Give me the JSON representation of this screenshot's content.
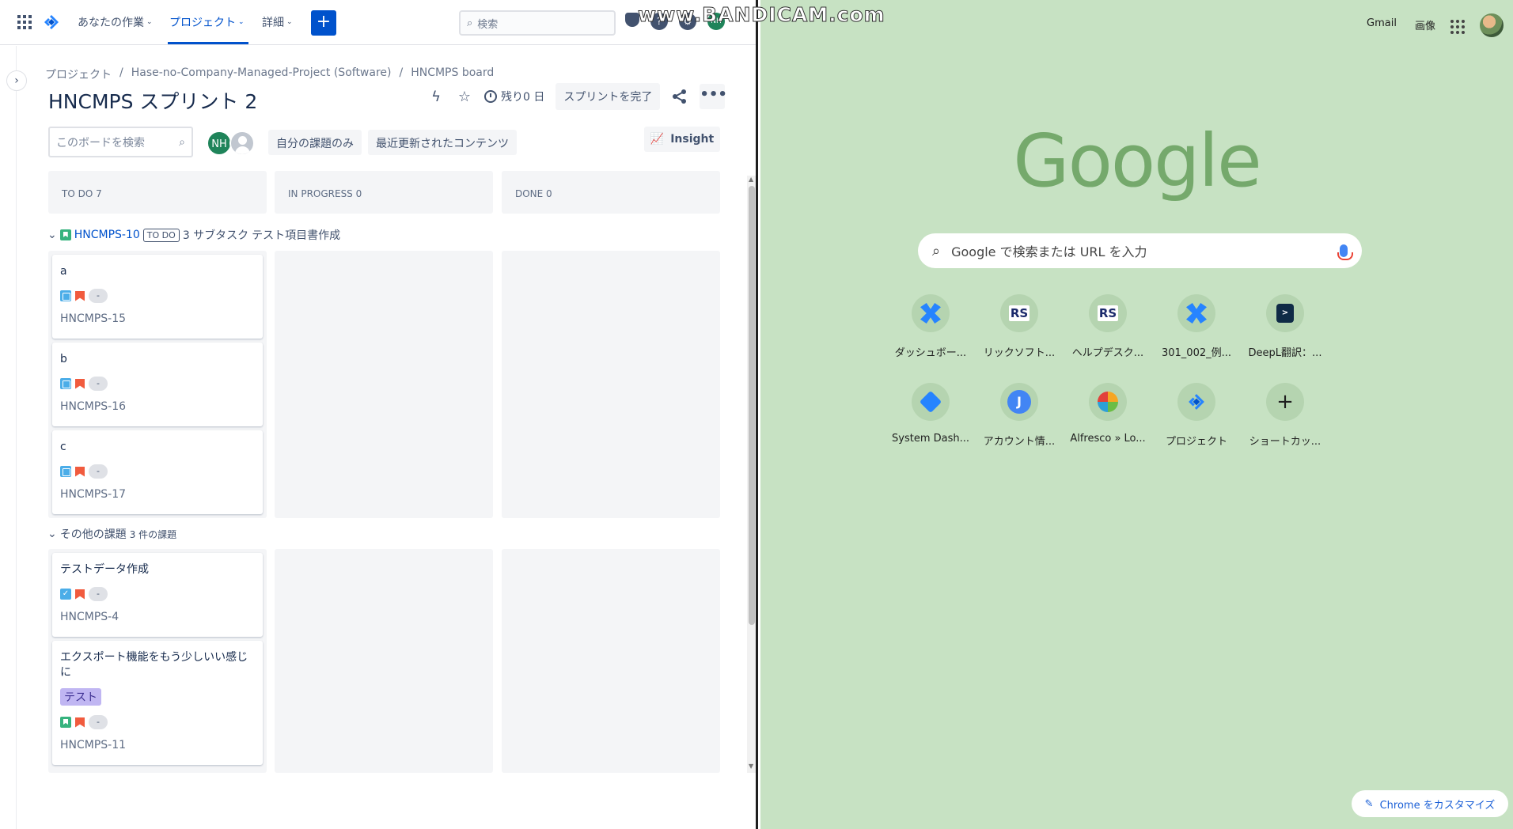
{
  "watermark": "www.BANDICAM.com",
  "jira": {
    "nav": {
      "your_work": "あなたの作業",
      "projects": "プロジェクト",
      "more": "詳細",
      "create": "+",
      "search_placeholder": "検索"
    },
    "breadcrumb": [
      "プロジェクト",
      "/",
      "Hase-no-Company-Managed-Project (Software)",
      "/",
      "HNCMPS board"
    ],
    "title": "HNCMPS スプリント 2",
    "remaining": "残り0 日",
    "complete_sprint": "スプリントを完了",
    "more_actions": "•••",
    "board_search_placeholder": "このボードを検索",
    "avatar_initials": "NH",
    "filters": {
      "only_my_issues": "自分の課題のみ",
      "recently_updated": "最近更新されたコンテンツ"
    },
    "insight": "Insight",
    "columns": [
      {
        "label": "TO DO 7"
      },
      {
        "label": "IN PROGRESS 0"
      },
      {
        "label": "DONE 0"
      }
    ],
    "swimlane1": {
      "key": "HNCMPS-10",
      "status": "TO DO",
      "subtasks": "3 サブタスク",
      "summary": "テスト項目書作成"
    },
    "swimlane2": {
      "name": "その他の課題",
      "count": "3 件の課題"
    },
    "cards_lane1": [
      {
        "summary": "a",
        "estimate": "-",
        "key": "HNCMPS-15"
      },
      {
        "summary": "b",
        "estimate": "-",
        "key": "HNCMPS-16"
      },
      {
        "summary": "c",
        "estimate": "-",
        "key": "HNCMPS-17"
      }
    ],
    "cards_lane2": [
      {
        "summary": "テストデータ作成",
        "estimate": "-",
        "key": "HNCMPS-4"
      },
      {
        "summary": "エクスポート機能をもう少しいい感じに",
        "label": "テスト",
        "estimate": "-",
        "key": "HNCMPS-11"
      }
    ]
  },
  "chrome": {
    "gmail": "Gmail",
    "images": "画像",
    "logo": "Google",
    "search_placeholder": "Google で検索または URL を入力",
    "shortcuts": [
      {
        "label": "ダッシュボー...",
        "icon": "confluence-icon"
      },
      {
        "label": "リックソフト...",
        "icon": "rs-icon"
      },
      {
        "label": "ヘルプデスク...",
        "icon": "rs-icon"
      },
      {
        "label": "301_002_例...",
        "icon": "confluence-icon"
      },
      {
        "label": "DeepL翻訳：...",
        "icon": "deepl-icon"
      },
      {
        "label": "System Dash...",
        "icon": "jira-sd-icon"
      },
      {
        "label": "アカウント情...",
        "icon": "j-icon"
      },
      {
        "label": "Alfresco » Lo...",
        "icon": "alfresco-icon"
      },
      {
        "label": "プロジェクト",
        "icon": "jira-icon"
      },
      {
        "label": "ショートカッ...",
        "icon": "plus-icon"
      }
    ],
    "customize": "Chrome をカスタマイズ"
  }
}
